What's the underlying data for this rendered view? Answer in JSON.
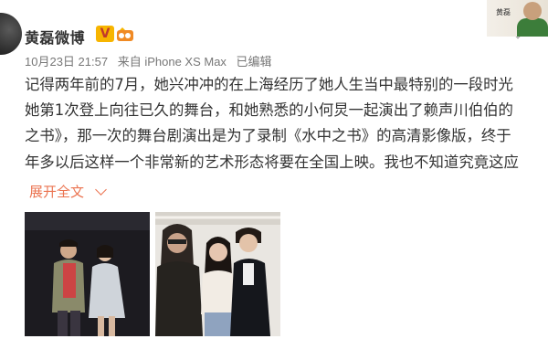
{
  "post": {
    "author": "黄磊微博",
    "verified_badge": "V",
    "date": "10月23日 21:57",
    "source": "来自 iPhone XS Max",
    "edited": "已编辑",
    "lines": [
      "记得两年前的7月，她兴冲冲的在上海经历了她人生当中最特别的一段时光",
      "她第1次登上向往已久的舞台，和她熟悉的小何炅一起演出了赖声川伯伯的",
      "之书》，那一次的舞台剧演出是为了录制《水中之书》的高清影像版，终于",
      "年多以后这样一个非常新的艺术形态将要在全国上映。我也不知道究竟这应"
    ],
    "expand_label": "展开全文"
  },
  "corner_photo": {
    "tag": "黄磊"
  },
  "colors": {
    "link": "#eb7350",
    "badge": "#f7b500"
  },
  "icons": [
    "avatar",
    "verified-badge-icon",
    "member-badge-icon",
    "chevron-down-icon",
    "expand-chevron-icon"
  ]
}
